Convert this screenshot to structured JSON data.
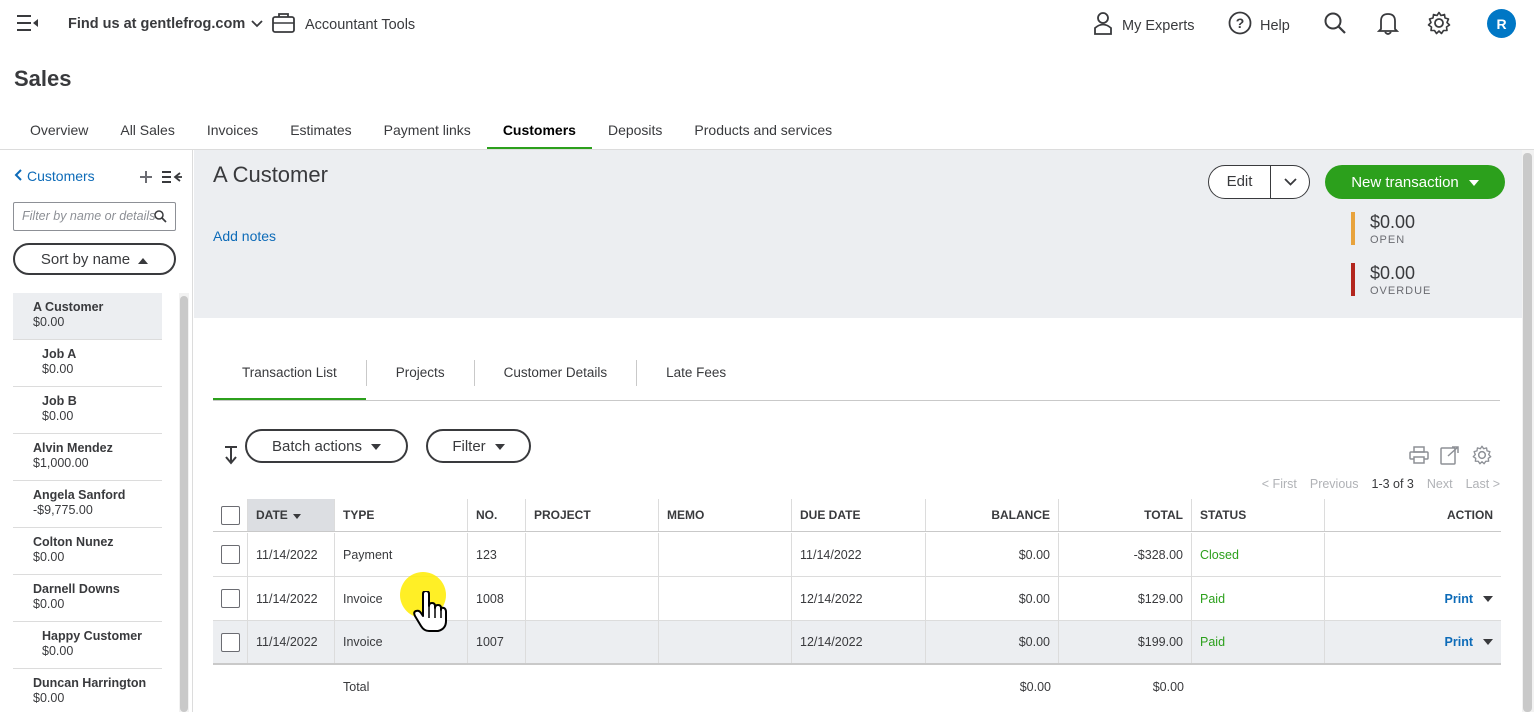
{
  "topbar": {
    "company": "Find us at gentlefrog.com",
    "accountant_tools": "Accountant Tools",
    "my_experts": "My Experts",
    "help": "Help",
    "avatar_initial": "R"
  },
  "page": {
    "title": "Sales"
  },
  "sales_tabs": [
    {
      "label": "Overview"
    },
    {
      "label": "All Sales"
    },
    {
      "label": "Invoices"
    },
    {
      "label": "Estimates"
    },
    {
      "label": "Payment links"
    },
    {
      "label": "Customers",
      "active": true
    },
    {
      "label": "Deposits"
    },
    {
      "label": "Products and services"
    }
  ],
  "left_panel": {
    "back_label": "Customers",
    "filter_placeholder": "Filter by name or details",
    "sort_label": "Sort by name",
    "customers": [
      {
        "name": "A Customer",
        "balance": "$0.00",
        "sub": false,
        "selected": true
      },
      {
        "name": "Job A",
        "balance": "$0.00",
        "sub": true
      },
      {
        "name": "Job B",
        "balance": "$0.00",
        "sub": true
      },
      {
        "name": "Alvin Mendez",
        "balance": "$1,000.00",
        "sub": false
      },
      {
        "name": "Angela Sanford",
        "balance": "-$9,775.00",
        "sub": false
      },
      {
        "name": "Colton Nunez",
        "balance": "$0.00",
        "sub": false
      },
      {
        "name": "Darnell Downs",
        "balance": "$0.00",
        "sub": false
      },
      {
        "name": "Happy Customer",
        "balance": "$0.00",
        "sub": true
      },
      {
        "name": "Duncan Harrington",
        "balance": "$0.00",
        "sub": false
      }
    ]
  },
  "customer_header": {
    "name": "A Customer",
    "add_notes": "Add notes",
    "edit_label": "Edit",
    "new_transaction_label": "New transaction",
    "open_amount": "$0.00",
    "open_label": "OPEN",
    "overdue_amount": "$0.00",
    "overdue_label": "OVERDUE",
    "open_color": "#e8a33d",
    "overdue_color": "#b3261e"
  },
  "sub_tabs": [
    {
      "label": "Transaction List",
      "active": true
    },
    {
      "label": "Projects"
    },
    {
      "label": "Customer Details"
    },
    {
      "label": "Late Fees"
    }
  ],
  "toolbar": {
    "batch_actions": "Batch actions",
    "filter": "Filter"
  },
  "pager": {
    "first": "< First",
    "previous": "Previous",
    "count": "1-3 of 3",
    "next": "Next",
    "last": "Last >"
  },
  "table": {
    "columns": [
      "DATE",
      "TYPE",
      "NO.",
      "PROJECT",
      "MEMO",
      "DUE DATE",
      "BALANCE",
      "TOTAL",
      "STATUS",
      "ACTION"
    ],
    "rows": [
      {
        "date": "11/14/2022",
        "type": "Payment",
        "no": "123",
        "project": "",
        "memo": "",
        "due_date": "11/14/2022",
        "balance": "$0.00",
        "total": "-$328.00",
        "status": "Closed",
        "action": ""
      },
      {
        "date": "11/14/2022",
        "type": "Invoice",
        "no": "1008",
        "project": "",
        "memo": "",
        "due_date": "12/14/2022",
        "balance": "$0.00",
        "total": "$129.00",
        "status": "Paid",
        "action": "Print"
      },
      {
        "date": "11/14/2022",
        "type": "Invoice",
        "no": "1007",
        "project": "",
        "memo": "",
        "due_date": "12/14/2022",
        "balance": "$0.00",
        "total": "$199.00",
        "status": "Paid",
        "action": "Print"
      }
    ],
    "total_label": "Total",
    "total_balance": "$0.00",
    "total_total": "$0.00"
  },
  "colors": {
    "accent_green": "#2ca01c",
    "link_blue": "#0d6bb8",
    "avatar_blue": "#0077c5"
  }
}
